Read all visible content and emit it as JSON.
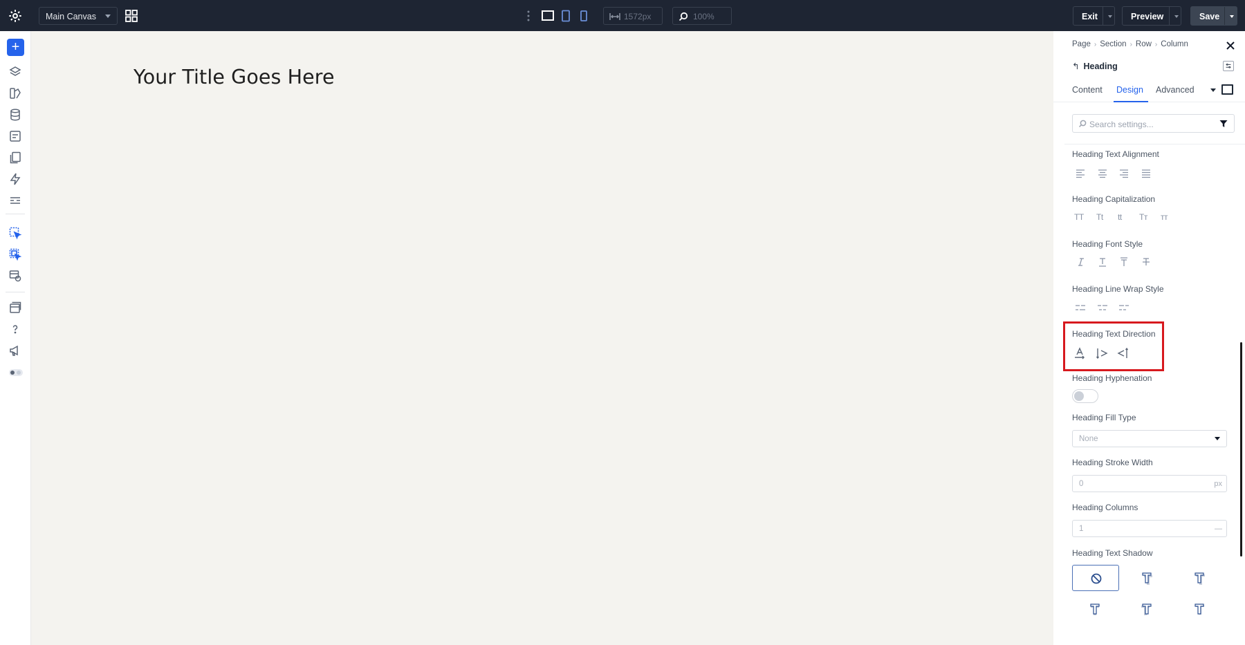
{
  "topbar": {
    "canvas_select": "Main Canvas",
    "width_value": "1572px",
    "zoom_value": "100%",
    "exit_label": "Exit",
    "preview_label": "Preview",
    "save_label": "Save"
  },
  "canvas": {
    "title": "Your Title Goes Here"
  },
  "panel": {
    "breadcrumb": [
      "Page",
      "Section",
      "Row",
      "Column"
    ],
    "element_title": "Heading",
    "tabs": [
      "Content",
      "Design",
      "Advanced"
    ],
    "active_tab": "Design",
    "search_placeholder": "Search settings...",
    "sections": {
      "text_alignment": "Heading Text Alignment",
      "capitalization": "Heading Capitalization",
      "font_style": "Heading Font Style",
      "line_wrap": "Heading Line Wrap Style",
      "text_direction": "Heading Text Direction",
      "hyphenation": "Heading Hyphenation",
      "fill_type": "Heading Fill Type",
      "stroke_width": "Heading Stroke Width",
      "columns": "Heading Columns",
      "text_shadow": "Heading Text Shadow"
    },
    "capitalization_glyphs": [
      "TT",
      "Tt",
      "tt",
      "Tт",
      "тт"
    ],
    "fill_type_value": "None",
    "stroke_width_value": "0",
    "stroke_width_unit": "px",
    "columns_value": "1",
    "columns_unit": "—",
    "hyphenation_on": false,
    "highlight_color": "#d7191e",
    "accent_color": "#2563eb"
  }
}
